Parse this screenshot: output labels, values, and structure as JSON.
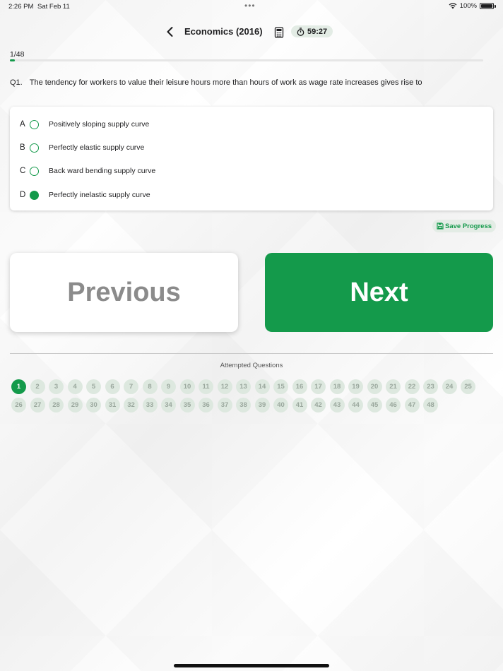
{
  "status_bar": {
    "time": "2:26 PM",
    "date": "Sat Feb 11",
    "battery": "100%"
  },
  "nav": {
    "title": "Economics (2016)",
    "timer": "59:27"
  },
  "progress": {
    "label": "1/48",
    "current": 1,
    "total": 48
  },
  "question": {
    "number": "Q1.",
    "text": "The tendency for workers to value their leisure hours more than hours of work as wage rate increases gives rise to"
  },
  "options": [
    {
      "letter": "A",
      "text": "Positively sloping supply curve",
      "selected": false
    },
    {
      "letter": "B",
      "text": "Perfectly elastic supply curve",
      "selected": false
    },
    {
      "letter": "C",
      "text": "Back ward bending supply curve",
      "selected": false
    },
    {
      "letter": "D",
      "text": "Perfectly inelastic supply curve",
      "selected": true
    }
  ],
  "actions": {
    "save_progress": "Save Progress",
    "previous": "Previous",
    "next": "Next"
  },
  "attempted": {
    "label": "Attempted Questions",
    "numbers": [
      "1",
      "2",
      "3",
      "4",
      "5",
      "6",
      "7",
      "8",
      "9",
      "10",
      "11",
      "12",
      "13",
      "14",
      "15",
      "16",
      "17",
      "18",
      "19",
      "20",
      "21",
      "22",
      "23",
      "24",
      "25",
      "26",
      "27",
      "28",
      "29",
      "30",
      "31",
      "32",
      "33",
      "34",
      "35",
      "36",
      "37",
      "38",
      "39",
      "40",
      "41",
      "42",
      "43",
      "44",
      "45",
      "46",
      "47",
      "48"
    ],
    "current": "1"
  },
  "colors": {
    "accent": "#149a4b",
    "pill_bg": "#e3ece5",
    "dot_bg": "#dde8df"
  }
}
